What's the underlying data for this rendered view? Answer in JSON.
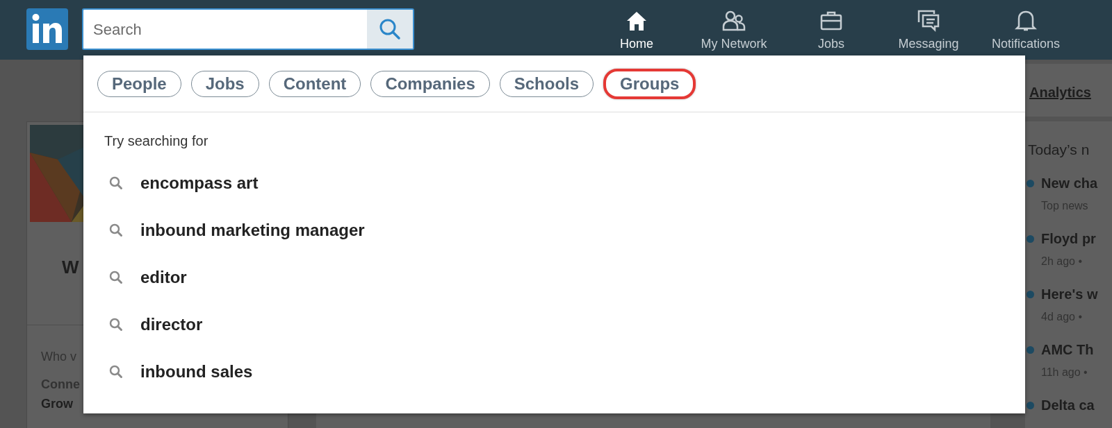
{
  "header": {
    "search": {
      "placeholder": "Search"
    },
    "nav": [
      {
        "label": "Home",
        "selected": true
      },
      {
        "label": "My Network",
        "selected": false
      },
      {
        "label": "Jobs",
        "selected": false
      },
      {
        "label": "Messaging",
        "selected": false
      },
      {
        "label": "Notifications",
        "selected": false
      }
    ]
  },
  "left_card": {
    "heading": "W",
    "section_label": "Who v",
    "stat_label": "Conne",
    "stat_value": "Grow"
  },
  "right_column": {
    "analytics_link": "Analytics",
    "news_title": "Today’s n",
    "news": [
      {
        "headline": "New cha",
        "meta": "Top news"
      },
      {
        "headline": "Floyd pr",
        "meta": "2h ago •"
      },
      {
        "headline": "Here's w",
        "meta": "4d ago •"
      },
      {
        "headline": "AMC Th",
        "meta": "11h ago •"
      },
      {
        "headline": "Delta ca"
      }
    ]
  },
  "search_dropdown": {
    "filters": [
      {
        "label": "People",
        "highlighted": false
      },
      {
        "label": "Jobs",
        "highlighted": false
      },
      {
        "label": "Content",
        "highlighted": false
      },
      {
        "label": "Companies",
        "highlighted": false
      },
      {
        "label": "Schools",
        "highlighted": false
      },
      {
        "label": "Groups",
        "highlighted": true
      }
    ],
    "suggestions_title": "Try searching for",
    "suggestions": [
      "encompass art",
      "inbound marketing manager",
      "editor",
      "director",
      "inbound sales"
    ]
  }
}
